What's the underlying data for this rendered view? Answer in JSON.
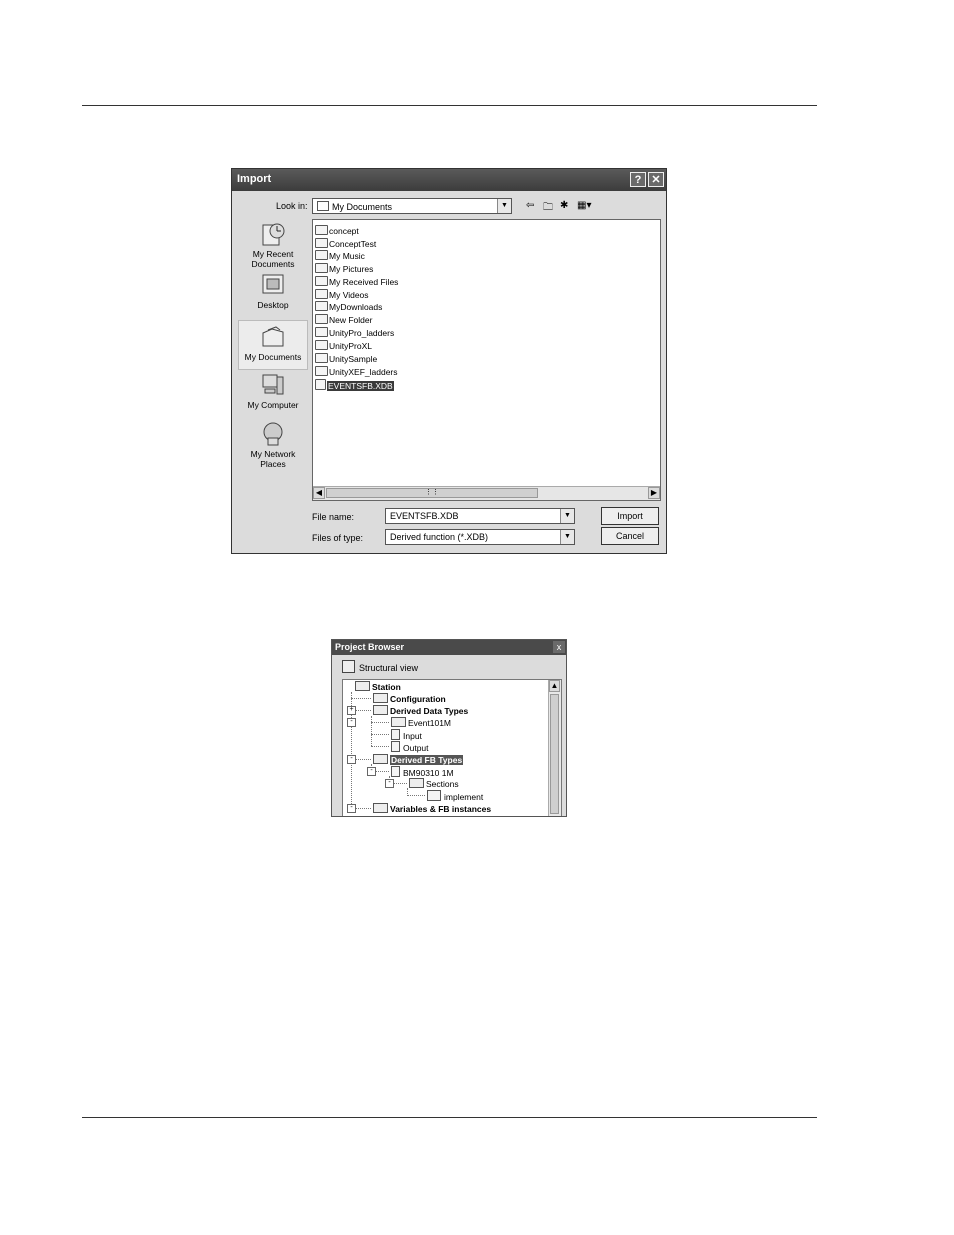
{
  "import_dialog": {
    "title": "Import",
    "help_label": "?",
    "close_label": "✕",
    "look_in_label": "Look in:",
    "look_in_value": "My Documents",
    "places": [
      {
        "label": "My Recent Documents",
        "icon": "recent-documents-icon"
      },
      {
        "label": "Desktop",
        "icon": "desktop-icon"
      },
      {
        "label": "My Documents",
        "icon": "my-documents-icon"
      },
      {
        "label": "My Computer",
        "icon": "my-computer-icon"
      },
      {
        "label": "My Network Places",
        "icon": "network-places-icon"
      }
    ],
    "files": [
      "concept",
      "ConceptTest",
      "My Music",
      "My Pictures",
      "My Received Files",
      "My Videos",
      "MyDownloads",
      "New Folder",
      "UnityPro_ladders",
      "UnityProXL",
      "UnitySample",
      "UnityXEF_ladders",
      "EVENTSFB.XDB"
    ],
    "selected_file": "EVENTSFB.XDB",
    "file_name_label": "File name:",
    "file_name_value": "EVENTSFB.XDB",
    "file_type_label": "Files of type:",
    "file_type_value": "Derived function (*.XDB)",
    "import_button": "Import",
    "cancel_button": "Cancel"
  },
  "project_browser": {
    "title": "Project Browser",
    "close_label": "x",
    "view_label": "Structural view",
    "tree": [
      {
        "label": "Station",
        "bold": true,
        "depth": 0
      },
      {
        "label": "Configuration",
        "bold": true,
        "depth": 1,
        "toggle": "+"
      },
      {
        "label": "Derived Data Types",
        "bold": true,
        "depth": 1,
        "toggle": "-"
      },
      {
        "label": "Event101M",
        "bold": false,
        "depth": 2
      },
      {
        "label": "Input",
        "bold": false,
        "depth": 2
      },
      {
        "label": "Output",
        "bold": false,
        "depth": 2
      },
      {
        "label": "Derived FB Types",
        "bold": true,
        "depth": 1,
        "toggle": "-",
        "selected": true
      },
      {
        "label": "BM90310 1M",
        "bold": false,
        "depth": 2,
        "toggle": "-"
      },
      {
        "label": "Sections",
        "bold": false,
        "depth": 3,
        "toggle": "-"
      },
      {
        "label": "implement",
        "bold": false,
        "depth": 4
      },
      {
        "label": "Variables & FB instances",
        "bold": true,
        "depth": 1,
        "toggle": "-"
      }
    ]
  }
}
